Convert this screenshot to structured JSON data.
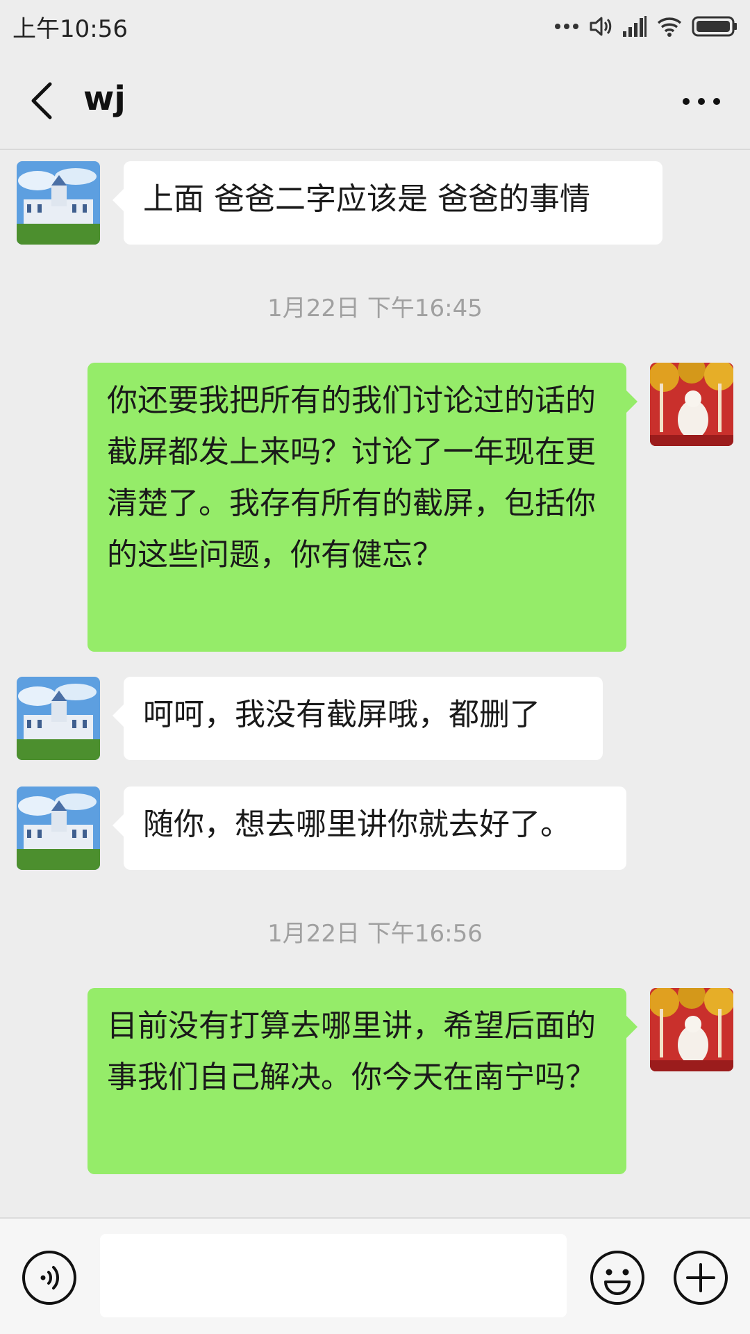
{
  "status_bar": {
    "time": "上午10:56"
  },
  "header": {
    "title": "wj",
    "back_icon": "chevron-left-icon",
    "more_icon": "more-dots-icon"
  },
  "messages": [
    {
      "type": "incoming",
      "text": "上面 爸爸二字应该是 爸爸的事情"
    },
    {
      "type": "timestamp",
      "text": "1月22日 下午16:45"
    },
    {
      "type": "outgoing",
      "text": "你还要我把所有的我们讨论过的话的截屏都发上来吗？讨论了一年现在更清楚了。我存有所有的截屏，包括你的这些问题，你有健忘？"
    },
    {
      "type": "incoming",
      "text": "呵呵，我没有截屏哦，都删了"
    },
    {
      "type": "incoming",
      "text": "随你，想去哪里讲你就去好了。"
    },
    {
      "type": "timestamp",
      "text": "1月22日 下午16:56"
    },
    {
      "type": "outgoing",
      "text": "目前没有打算去哪里讲，希望后面的事我们自己解决。你今天在南宁吗？"
    }
  ],
  "input_bar": {
    "value": "",
    "placeholder": "",
    "voice_icon": "voice-icon",
    "emoji_icon": "emoji-icon",
    "plus_icon": "plus-icon"
  },
  "colors": {
    "background": "#ededed",
    "outgoing_bubble": "#95ec69",
    "incoming_bubble": "#ffffff"
  }
}
